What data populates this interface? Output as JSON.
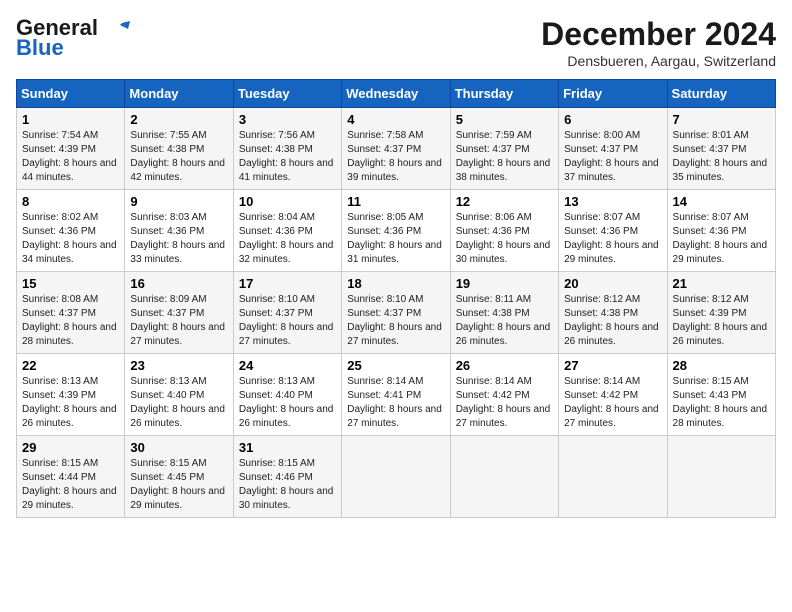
{
  "header": {
    "logo_line1": "General",
    "logo_line2": "Blue",
    "month_title": "December 2024",
    "subtitle": "Densbueren, Aargau, Switzerland"
  },
  "weekdays": [
    "Sunday",
    "Monday",
    "Tuesday",
    "Wednesday",
    "Thursday",
    "Friday",
    "Saturday"
  ],
  "weeks": [
    [
      {
        "day": "1",
        "sunrise": "Sunrise: 7:54 AM",
        "sunset": "Sunset: 4:39 PM",
        "daylight": "Daylight: 8 hours and 44 minutes."
      },
      {
        "day": "2",
        "sunrise": "Sunrise: 7:55 AM",
        "sunset": "Sunset: 4:38 PM",
        "daylight": "Daylight: 8 hours and 42 minutes."
      },
      {
        "day": "3",
        "sunrise": "Sunrise: 7:56 AM",
        "sunset": "Sunset: 4:38 PM",
        "daylight": "Daylight: 8 hours and 41 minutes."
      },
      {
        "day": "4",
        "sunrise": "Sunrise: 7:58 AM",
        "sunset": "Sunset: 4:37 PM",
        "daylight": "Daylight: 8 hours and 39 minutes."
      },
      {
        "day": "5",
        "sunrise": "Sunrise: 7:59 AM",
        "sunset": "Sunset: 4:37 PM",
        "daylight": "Daylight: 8 hours and 38 minutes."
      },
      {
        "day": "6",
        "sunrise": "Sunrise: 8:00 AM",
        "sunset": "Sunset: 4:37 PM",
        "daylight": "Daylight: 8 hours and 37 minutes."
      },
      {
        "day": "7",
        "sunrise": "Sunrise: 8:01 AM",
        "sunset": "Sunset: 4:37 PM",
        "daylight": "Daylight: 8 hours and 35 minutes."
      }
    ],
    [
      {
        "day": "8",
        "sunrise": "Sunrise: 8:02 AM",
        "sunset": "Sunset: 4:36 PM",
        "daylight": "Daylight: 8 hours and 34 minutes."
      },
      {
        "day": "9",
        "sunrise": "Sunrise: 8:03 AM",
        "sunset": "Sunset: 4:36 PM",
        "daylight": "Daylight: 8 hours and 33 minutes."
      },
      {
        "day": "10",
        "sunrise": "Sunrise: 8:04 AM",
        "sunset": "Sunset: 4:36 PM",
        "daylight": "Daylight: 8 hours and 32 minutes."
      },
      {
        "day": "11",
        "sunrise": "Sunrise: 8:05 AM",
        "sunset": "Sunset: 4:36 PM",
        "daylight": "Daylight: 8 hours and 31 minutes."
      },
      {
        "day": "12",
        "sunrise": "Sunrise: 8:06 AM",
        "sunset": "Sunset: 4:36 PM",
        "daylight": "Daylight: 8 hours and 30 minutes."
      },
      {
        "day": "13",
        "sunrise": "Sunrise: 8:07 AM",
        "sunset": "Sunset: 4:36 PM",
        "daylight": "Daylight: 8 hours and 29 minutes."
      },
      {
        "day": "14",
        "sunrise": "Sunrise: 8:07 AM",
        "sunset": "Sunset: 4:36 PM",
        "daylight": "Daylight: 8 hours and 29 minutes."
      }
    ],
    [
      {
        "day": "15",
        "sunrise": "Sunrise: 8:08 AM",
        "sunset": "Sunset: 4:37 PM",
        "daylight": "Daylight: 8 hours and 28 minutes."
      },
      {
        "day": "16",
        "sunrise": "Sunrise: 8:09 AM",
        "sunset": "Sunset: 4:37 PM",
        "daylight": "Daylight: 8 hours and 27 minutes."
      },
      {
        "day": "17",
        "sunrise": "Sunrise: 8:10 AM",
        "sunset": "Sunset: 4:37 PM",
        "daylight": "Daylight: 8 hours and 27 minutes."
      },
      {
        "day": "18",
        "sunrise": "Sunrise: 8:10 AM",
        "sunset": "Sunset: 4:37 PM",
        "daylight": "Daylight: 8 hours and 27 minutes."
      },
      {
        "day": "19",
        "sunrise": "Sunrise: 8:11 AM",
        "sunset": "Sunset: 4:38 PM",
        "daylight": "Daylight: 8 hours and 26 minutes."
      },
      {
        "day": "20",
        "sunrise": "Sunrise: 8:12 AM",
        "sunset": "Sunset: 4:38 PM",
        "daylight": "Daylight: 8 hours and 26 minutes."
      },
      {
        "day": "21",
        "sunrise": "Sunrise: 8:12 AM",
        "sunset": "Sunset: 4:39 PM",
        "daylight": "Daylight: 8 hours and 26 minutes."
      }
    ],
    [
      {
        "day": "22",
        "sunrise": "Sunrise: 8:13 AM",
        "sunset": "Sunset: 4:39 PM",
        "daylight": "Daylight: 8 hours and 26 minutes."
      },
      {
        "day": "23",
        "sunrise": "Sunrise: 8:13 AM",
        "sunset": "Sunset: 4:40 PM",
        "daylight": "Daylight: 8 hours and 26 minutes."
      },
      {
        "day": "24",
        "sunrise": "Sunrise: 8:13 AM",
        "sunset": "Sunset: 4:40 PM",
        "daylight": "Daylight: 8 hours and 26 minutes."
      },
      {
        "day": "25",
        "sunrise": "Sunrise: 8:14 AM",
        "sunset": "Sunset: 4:41 PM",
        "daylight": "Daylight: 8 hours and 27 minutes."
      },
      {
        "day": "26",
        "sunrise": "Sunrise: 8:14 AM",
        "sunset": "Sunset: 4:42 PM",
        "daylight": "Daylight: 8 hours and 27 minutes."
      },
      {
        "day": "27",
        "sunrise": "Sunrise: 8:14 AM",
        "sunset": "Sunset: 4:42 PM",
        "daylight": "Daylight: 8 hours and 27 minutes."
      },
      {
        "day": "28",
        "sunrise": "Sunrise: 8:15 AM",
        "sunset": "Sunset: 4:43 PM",
        "daylight": "Daylight: 8 hours and 28 minutes."
      }
    ],
    [
      {
        "day": "29",
        "sunrise": "Sunrise: 8:15 AM",
        "sunset": "Sunset: 4:44 PM",
        "daylight": "Daylight: 8 hours and 29 minutes."
      },
      {
        "day": "30",
        "sunrise": "Sunrise: 8:15 AM",
        "sunset": "Sunset: 4:45 PM",
        "daylight": "Daylight: 8 hours and 29 minutes."
      },
      {
        "day": "31",
        "sunrise": "Sunrise: 8:15 AM",
        "sunset": "Sunset: 4:46 PM",
        "daylight": "Daylight: 8 hours and 30 minutes."
      },
      null,
      null,
      null,
      null
    ]
  ]
}
